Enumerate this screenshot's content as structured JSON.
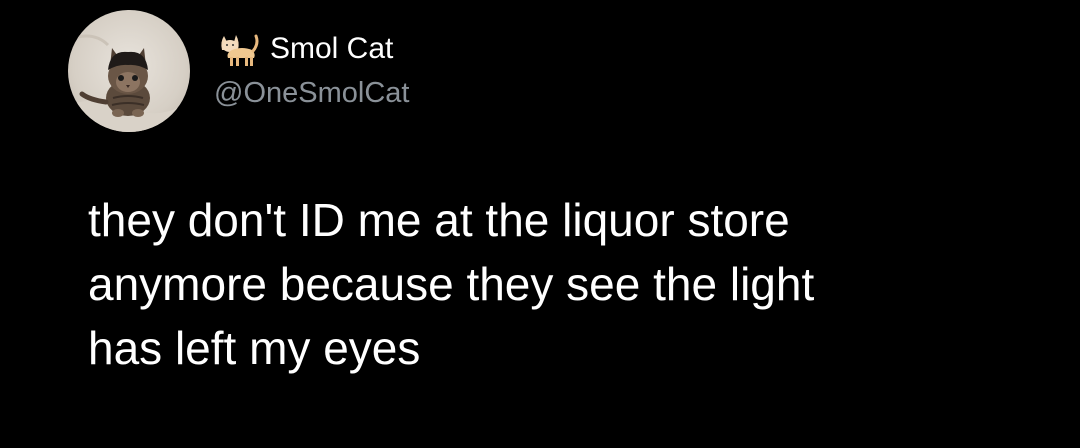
{
  "author": {
    "display_name": "Smol Cat",
    "handle": "@OneSmolCat",
    "name_emoji": "cat-emoji-icon",
    "avatar": "kitten-avatar"
  },
  "tweet": {
    "lines": [
      "they don't ID me at the liquor store",
      "anymore because they see the light",
      "has left my eyes"
    ]
  },
  "colors": {
    "background": "#000000",
    "text": "#ffffff",
    "handle": "#8a9198"
  }
}
